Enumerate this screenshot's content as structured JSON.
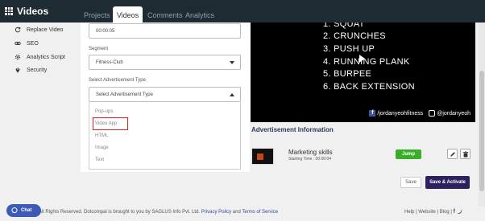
{
  "app": {
    "title": "Videos"
  },
  "tabs": [
    {
      "label": "Projects",
      "active": false
    },
    {
      "label": "Videos",
      "active": true
    },
    {
      "label": "Comments",
      "active": false
    },
    {
      "label": "Analytics",
      "active": false
    }
  ],
  "sidebar": {
    "items": [
      {
        "label": "Replace Video",
        "icon": "refresh-icon"
      },
      {
        "label": "SEO",
        "icon": "link-icon"
      },
      {
        "label": "Analytics Script",
        "icon": "gear-icon"
      },
      {
        "label": "Security",
        "icon": "location-pin-icon"
      }
    ]
  },
  "form": {
    "time_value": "00:00:05",
    "segment_label": "Segment",
    "segment_value": "Fitness-Club",
    "ad_type_label": "Select Advertisement Type",
    "ad_type_value": "Select Advertisement Type",
    "options": [
      "Pop-ups",
      "Video App",
      "HTML",
      "Image",
      "Text"
    ],
    "highlighted_option": "Video App"
  },
  "video": {
    "lines": [
      "1. SQUAT",
      "2. CRUNCHES",
      "3. PUSH UP",
      "4. RUNNING PLANK",
      "5. BURPEE",
      "6. BACK EXTENSION"
    ],
    "facebook_handle": "/jordanyeohfitness",
    "instagram_handle": "@jordanyeoh"
  },
  "ad_info": {
    "heading": "Advertisement Information",
    "title": "Marketing skills",
    "start_time": "Starting Time : 00:00:04",
    "jump_label": "Jump"
  },
  "actions": {
    "save_label": "Save",
    "activate_label": "Save & Activate"
  },
  "footer": {
    "copyright": "s. All Rights Reserved. Dotcompal is brought to you by SAGLUS Info Pvt. Ltd.",
    "privacy": "Privacy Policy",
    "and_text": "and",
    "terms": "Terms of Service",
    "links": [
      "Help",
      "Website",
      "Blog"
    ]
  },
  "chat": {
    "label": "Chat"
  },
  "colors": {
    "topbar": "#1e2b33",
    "jump": "#3aad2b",
    "activate": "#2e1f5e",
    "chat": "#3c5bb7",
    "highlight": "#dd2222"
  }
}
